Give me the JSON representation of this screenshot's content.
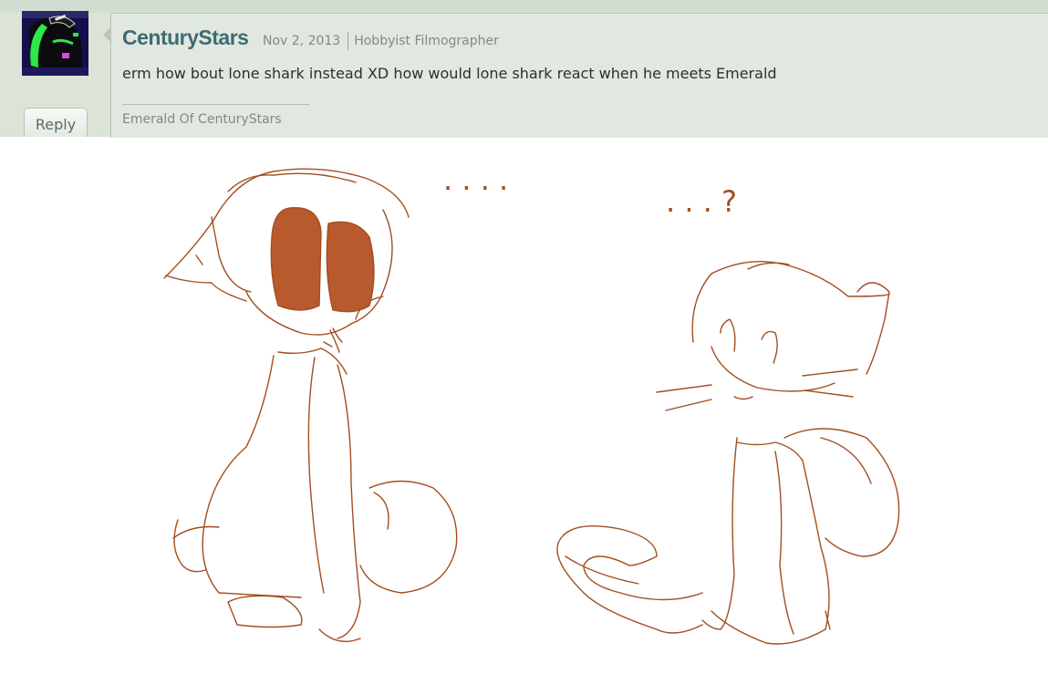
{
  "comment": {
    "author": "CenturyStars",
    "date": "Nov 2, 2013",
    "role": "Hobbyist Filmographer",
    "text": "erm how bout lone shark instead XD how would lone shark react when he meets Emerald",
    "signature": "Emerald Of CenturyStars",
    "reply_label": "Reply",
    "avatar_icon": "avatar-headphones-character"
  },
  "drawing": {
    "left_dots": ". . . .",
    "right_dots": ". . . ?",
    "line_color": "#a24e1f",
    "eye_fill": "#b85a2e"
  }
}
